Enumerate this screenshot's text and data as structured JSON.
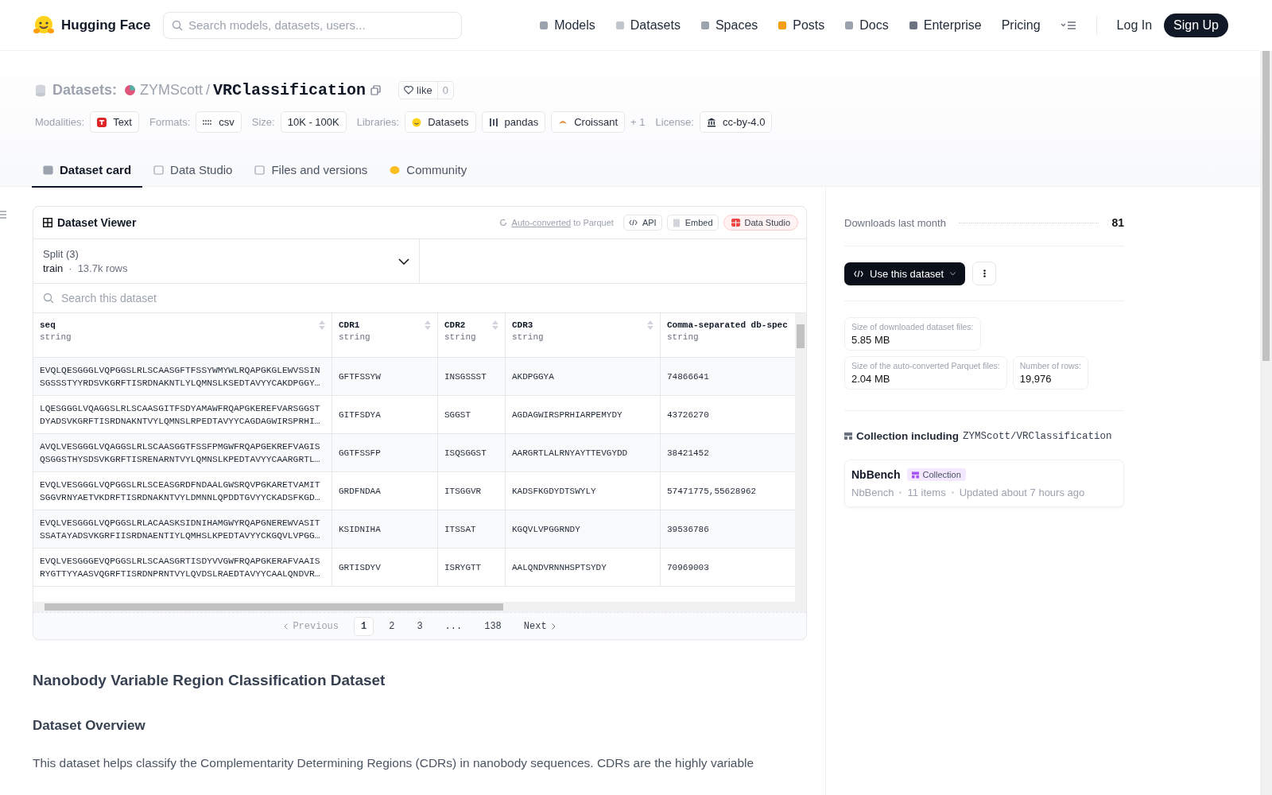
{
  "nav": {
    "brand": "Hugging Face",
    "search": {
      "placeholder": "Search models, datasets, users..."
    },
    "links": [
      {
        "label": "Models"
      },
      {
        "label": "Datasets"
      },
      {
        "label": "Spaces"
      },
      {
        "label": "Posts"
      },
      {
        "label": "Docs"
      },
      {
        "label": "Enterprise"
      },
      {
        "label": "Pricing"
      }
    ],
    "login": "Log In",
    "signup": "Sign Up"
  },
  "header": {
    "category": "Datasets:",
    "owner": "ZYMScott",
    "separator": "/",
    "name": "VRClassification",
    "like": {
      "label": "like",
      "count": "0"
    },
    "tag_groups": [
      {
        "label": "Modalities:",
        "chips": [
          {
            "text": "Text"
          }
        ]
      },
      {
        "label": "Formats:",
        "chips": [
          {
            "text": "csv"
          }
        ]
      },
      {
        "label": "Size:",
        "chips": [
          {
            "text": "10K - 100K"
          }
        ]
      },
      {
        "label": "Libraries:",
        "chips": [
          {
            "text": "Datasets"
          },
          {
            "text": "pandas"
          },
          {
            "text": "Croissant"
          }
        ],
        "more": "+ 1"
      },
      {
        "label": "License:",
        "chips": [
          {
            "text": "cc-by-4.0"
          }
        ]
      }
    ],
    "tabs": [
      {
        "label": "Dataset card",
        "selected": true
      },
      {
        "label": "Data Studio",
        "selected": false
      },
      {
        "label": "Files and versions",
        "selected": false
      },
      {
        "label": "Community",
        "selected": false
      }
    ]
  },
  "viewer": {
    "title": "Dataset Viewer",
    "converted_link": "Auto-converted",
    "converted_rest": "to Parquet",
    "buttons": [
      "API",
      "Embed",
      "Data Studio"
    ],
    "split": {
      "label": "Split (3)",
      "value": "train",
      "separator": "·",
      "rows": "13.7k rows"
    },
    "search": {
      "placeholder": "Search this dataset"
    },
    "columns": [
      {
        "name": "seq",
        "type": "string"
      },
      {
        "name": "CDR1",
        "type": "string"
      },
      {
        "name": "CDR2",
        "type": "string"
      },
      {
        "name": "CDR3",
        "type": "string"
      },
      {
        "name": "Comma-separated db-spec",
        "type": "string"
      }
    ],
    "rows": [
      [
        "EVQLQESGGGLVQPGGSLRLSCAASGFTFSSYWMYWLRQAPGKGLEWVSSINSGSSSTYYRDSVKGRFTISRDNAKNTLYLQMNSLKSEDTAVYYCAKDPGGY…",
        "GFTFSSYW",
        "INSGSSST",
        "AKDPGGYA",
        "74866641"
      ],
      [
        "LQESGGGLVQAGGSLRLSCAASGITFSDYAMAWFRQAPGKEREFVARSGGSTDYADSVKGRFTISRDNAKNTVYLQMNSLRPEDTAVYYCAGDAGWIRSPRHI…",
        "GITFSDYA",
        "SGGST",
        "AGDAGWIRSPRHIARPEMYDY",
        "43726270"
      ],
      [
        "AVQLVESGGGLVQAGGSLRLSCAASGGTFSSFPMGWFRQAPGEKREFVAGISQSGGSTHYSDSVKGRFTISRENARNTVYLQMNSLKPEDTAVYYCAARGRTL…",
        "GGTFSSFP",
        "ISQSGGST",
        "AARGRTLALRNYAYTTEVGYDD",
        "38421452"
      ],
      [
        "EVQLVESGGGLVQPGGSLRLSCEASGRDFNDAALGWSRQVPGKARETVAMITSGGVRNYAETVKDRFTISRDNAKNTVYLDMNNLQPDDTGVYYCKADSFKGD…",
        "GRDFNDAA",
        "ITSGGVR",
        "KADSFKGDYDTSWYLY",
        "57471775,55628962"
      ],
      [
        "EVQLVESGGGLVQPGGSLRLACAASKSIDNIHAMGWYRQAPGNEREWVASITSSATAYADSVKGRFIISRDNAENTIYLQMHSLKPEDTAVYYCKGQVLVPGG…",
        "KSIDNIHA",
        "ITSSAT",
        "KGQVLVPGGRNDY",
        "39536786"
      ],
      [
        "EVQLVESGGGEVQPGGSLRLSCAASGRTISDYVVGWFRQAPGKERAFVAAISRYGTTYYAASVQGRFTISRDNPRNTVYLQVDSLRAEDTAVYYCAALQNDVR…",
        "GRTISDYV",
        "ISRYGTT",
        "AALQNDVRNNHSPTSYDY",
        "70969003"
      ]
    ],
    "pagination": {
      "previous": "Previous",
      "pages": [
        {
          "label": "1",
          "selected": true
        },
        {
          "label": "2",
          "selected": false
        },
        {
          "label": "3",
          "selected": false
        },
        {
          "label": "...",
          "selected": false
        },
        {
          "label": "138",
          "selected": false
        }
      ],
      "next": "Next"
    }
  },
  "card": {
    "title": "Nanobody Variable Region Classification Dataset",
    "section": "Dataset Overview",
    "paragraph": "This dataset helps classify the Complementarity Determining Regions (CDRs) in nanobody sequences. CDRs are the highly variable"
  },
  "sidebar": {
    "downloads": {
      "label": "Downloads last month",
      "value": "81"
    },
    "use_button": "Use this dataset",
    "stats": [
      {
        "label": "Size of downloaded dataset files:",
        "value": "5.85 MB"
      },
      {
        "label": "Size of the auto-converted Parquet files:",
        "value": "2.04 MB"
      },
      {
        "label": "Number of rows:",
        "value": "19,976"
      }
    ],
    "collection": {
      "heading": "Collection including",
      "repo": "ZYMScott/VRClassification",
      "title": "NbBench",
      "badge": "Collection",
      "meta": [
        "NbBench",
        "11 items",
        "Updated about 7 hours ago"
      ]
    }
  }
}
